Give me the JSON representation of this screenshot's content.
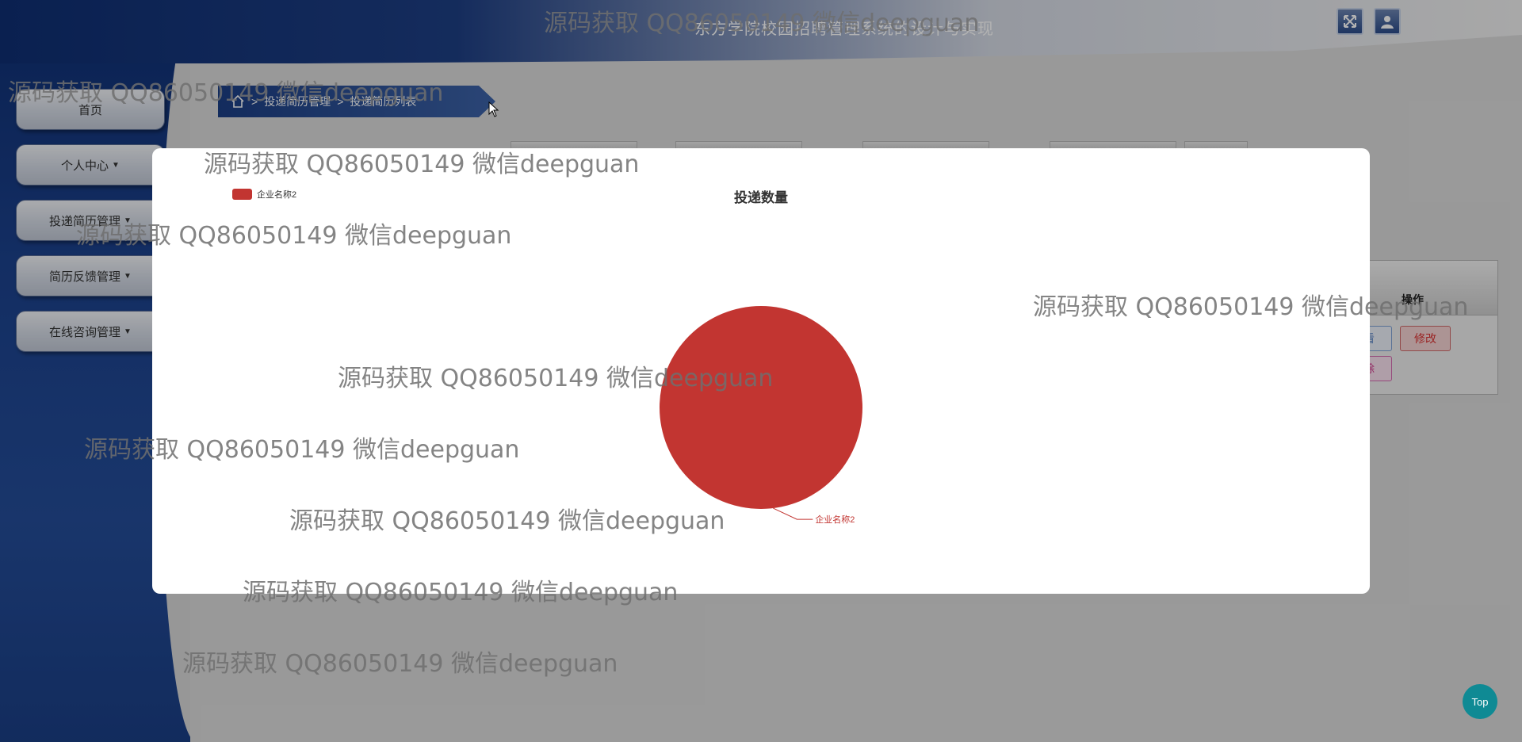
{
  "app": {
    "title": "东方学院校园招聘管理系统的设计与实现"
  },
  "sidebar": {
    "items": [
      {
        "label": "首页",
        "has_caret": false
      },
      {
        "label": "个人中心",
        "has_caret": true
      },
      {
        "label": "投递简历管理",
        "has_caret": true
      },
      {
        "label": "简历反馈管理",
        "has_caret": true
      },
      {
        "label": "在线咨询管理",
        "has_caret": true
      }
    ]
  },
  "breadcrumb": {
    "items": [
      "投递简历管理",
      "投递简历列表"
    ],
    "separator": ">"
  },
  "table": {
    "header_operation": "操作",
    "view_button_partial": "看",
    "edit_button": "修改",
    "delete_button_partial": "除"
  },
  "modal": {
    "chart_data": {
      "type": "pie",
      "title": "投递数量",
      "legend": [
        "企业名称2"
      ],
      "legend_position": "top-left",
      "slices": [
        {
          "name": "企业名称2",
          "value": 1,
          "color": "#c23531"
        }
      ]
    }
  },
  "watermark": {
    "text": "源码获取 QQ86050149 微信deepguan"
  },
  "top_button": {
    "label": "Top"
  },
  "colors": {
    "sidebar": "#1c428e",
    "accent": "#c23531",
    "top_button": "#0f8a94"
  }
}
